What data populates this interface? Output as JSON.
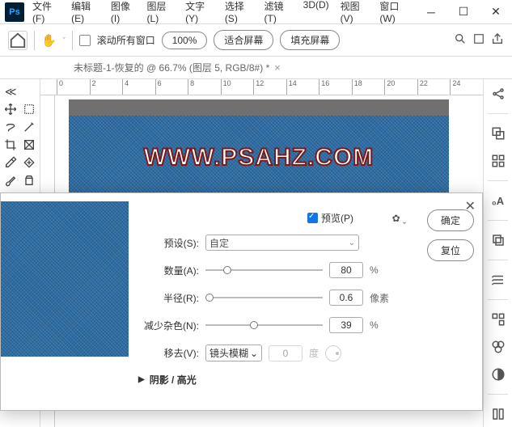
{
  "menubar": [
    "文件(F)",
    "编辑(E)",
    "图像(I)",
    "图层(L)",
    "文字(Y)",
    "选择(S)",
    "滤镜(T)",
    "3D(D)",
    "视图(V)",
    "窗口(W)"
  ],
  "optbar": {
    "scroll_all": "滚动所有窗口",
    "zoom": "100%",
    "fit": "适合屏幕",
    "fill": "填充屏幕"
  },
  "doc": {
    "title": "未标题-1-恢复的 @ 66.7% (图层 5, RGB/8#) *"
  },
  "ruler": [
    "0",
    "2",
    "4",
    "6",
    "8",
    "10",
    "12",
    "14",
    "16",
    "18",
    "20",
    "22",
    "24"
  ],
  "watermark": "WWW.PSAHZ.COM",
  "dialog": {
    "preview": "预览(P)",
    "ok": "确定",
    "reset": "复位",
    "preset_lbl": "预设(S):",
    "preset_val": "自定",
    "amount_lbl": "数量(A):",
    "amount_val": "80",
    "amount_unit": "%",
    "radius_lbl": "半径(R):",
    "radius_val": "0.6",
    "radius_unit": "像素",
    "noise_lbl": "减少杂色(N):",
    "noise_val": "39",
    "noise_unit": "%",
    "remove_lbl": "移去(V):",
    "remove_val": "镜头模糊",
    "remove_num": "0",
    "remove_unit": "度",
    "section": "阴影 / 高光"
  }
}
